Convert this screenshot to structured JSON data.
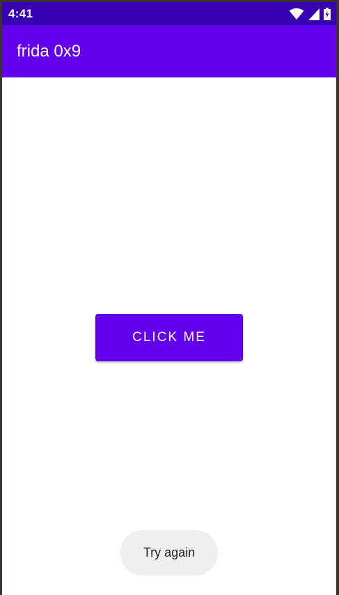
{
  "status_bar": {
    "time": "4:41",
    "icons": [
      "wifi-icon",
      "cellular-signal-icon",
      "battery-charging-icon"
    ]
  },
  "app_bar": {
    "title": "frida 0x9"
  },
  "main": {
    "button_label": "CLICK ME"
  },
  "toast": {
    "message": "Try again"
  },
  "colors": {
    "status_bar": "#3700b3",
    "primary": "#6200ee",
    "toast_background": "#efefef"
  }
}
